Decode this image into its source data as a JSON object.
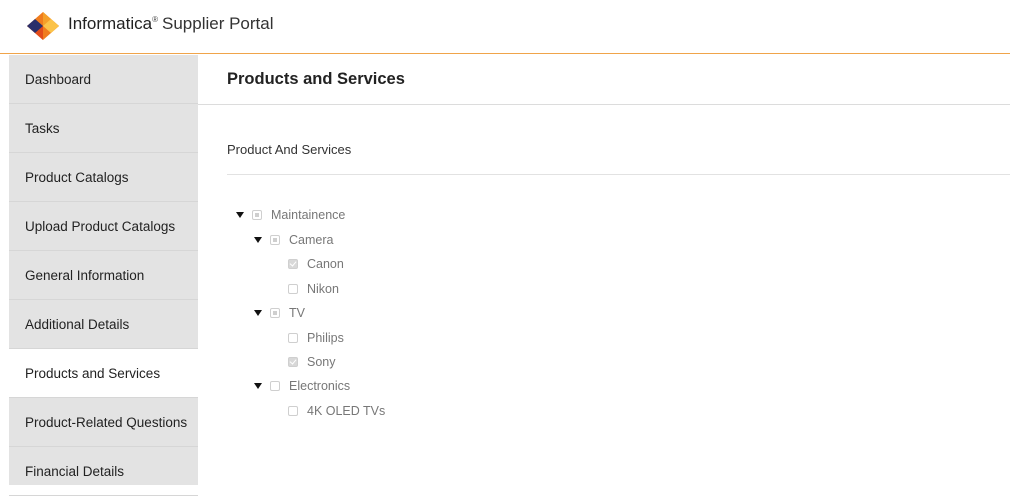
{
  "header": {
    "brand_name": "Informatica",
    "registered_mark": "®",
    "portal_name": "Supplier Portal",
    "accent_color": "#f0a44a",
    "logo_icon": "informatica-diamond-logo"
  },
  "sidebar": {
    "items": [
      {
        "label": "Dashboard",
        "active": false
      },
      {
        "label": "Tasks",
        "active": false
      },
      {
        "label": "Product Catalogs",
        "active": false
      },
      {
        "label": "Upload Product Catalogs",
        "active": false
      },
      {
        "label": "General Information",
        "active": false
      },
      {
        "label": "Additional Details",
        "active": false
      },
      {
        "label": "Products and Services",
        "active": true
      },
      {
        "label": "Product-Related Questions",
        "active": false
      },
      {
        "label": "Financial Details",
        "active": false
      }
    ]
  },
  "main": {
    "title": "Products and Services",
    "section_title": "Product And Services",
    "tree": [
      {
        "label": "Maintainence",
        "state": "partial",
        "expanded": true,
        "level": 0
      },
      {
        "label": "Camera",
        "state": "partial",
        "expanded": true,
        "level": 1
      },
      {
        "label": "Canon",
        "state": "checked",
        "level": 2
      },
      {
        "label": "Nikon",
        "state": "unchecked",
        "level": 2
      },
      {
        "label": "TV",
        "state": "partial",
        "expanded": true,
        "level": 1
      },
      {
        "label": "Philips",
        "state": "unchecked",
        "level": 2
      },
      {
        "label": "Sony",
        "state": "checked",
        "level": 2
      },
      {
        "label": "Electronics",
        "state": "unchecked",
        "expanded": true,
        "level": 1
      },
      {
        "label": "4K OLED TVs",
        "state": "unchecked",
        "level": 2
      }
    ]
  }
}
